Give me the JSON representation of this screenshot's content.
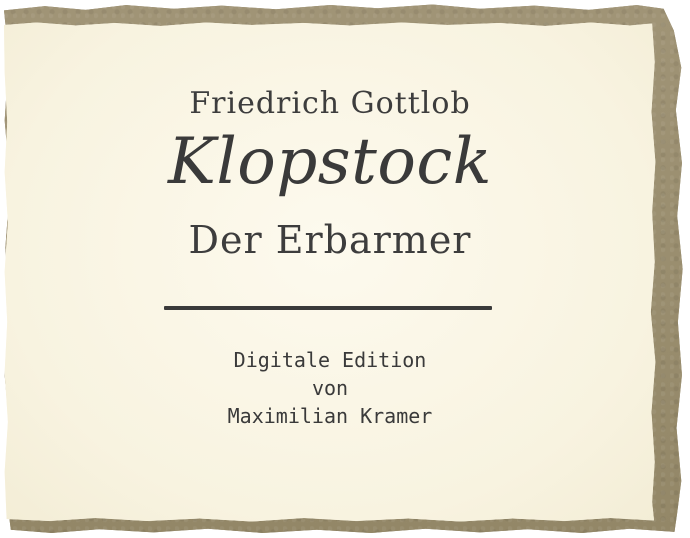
{
  "title_card": {
    "author_first": "Friedrich Gottlob",
    "author_last": "Klopstock",
    "work_title": "Der Erbarmer",
    "edition_line1": "Digitale Edition",
    "edition_line2": "von",
    "edition_line3": "Maximilian Kramer"
  },
  "colors": {
    "paper": "#fbf7e7",
    "backing": "#9a8e70",
    "ink": "#3a3a3a"
  }
}
